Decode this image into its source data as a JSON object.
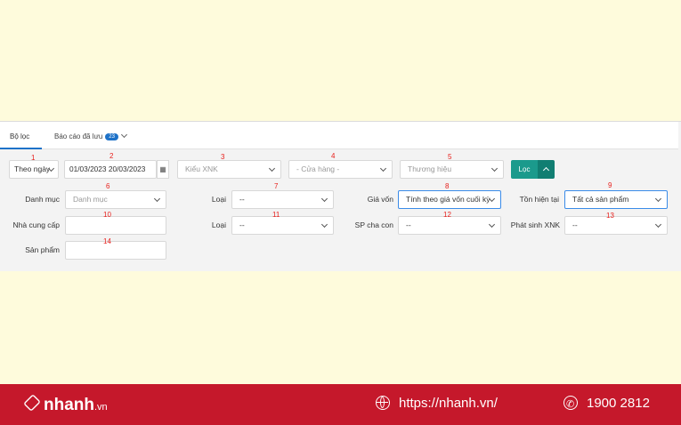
{
  "tabs": {
    "filter": "Bộ lọc",
    "saved": "Báo cáo đã lưu",
    "saved_count": "23"
  },
  "row1": {
    "period": "Theo ngày",
    "date_from": "01/03/2023",
    "date_to": "20/03/2023",
    "xnk_type": "Kiểu XNK",
    "store": "- Cửa hàng -",
    "brand": "Thương hiệu",
    "filter_button": "Lọc"
  },
  "row2": {
    "category_label": "Danh mục",
    "category_placeholder": "Danh mục",
    "type_label": "Loại",
    "type_value": "--",
    "cost_label": "Giá vốn",
    "cost_value": "Tính theo giá vốn cuối kỳ",
    "stock_label": "Tồn hiện tại",
    "stock_value": "Tất cả sản phẩm"
  },
  "row3": {
    "supplier_label": "Nhà cung cấp",
    "type_label": "Loại",
    "type_value": "--",
    "parent_label": "SP cha con",
    "parent_value": "--",
    "xnk_label": "Phát sinh XNK",
    "xnk_value": "--"
  },
  "row4": {
    "product_label": "Sản phẩm"
  },
  "markers": [
    "1",
    "2",
    "3",
    "4",
    "5",
    "6",
    "7",
    "8",
    "9",
    "10",
    "11",
    "12",
    "13",
    "14"
  ],
  "footer": {
    "brand": "nhanh",
    "brand_suffix": ".vn",
    "website": "https://nhanh.vn/",
    "hotline": "1900 2812"
  },
  "colors": {
    "accent": "#1e72c8",
    "button": "#1b9a8c",
    "footer": "#c5182b",
    "marker": "#e8201c"
  }
}
